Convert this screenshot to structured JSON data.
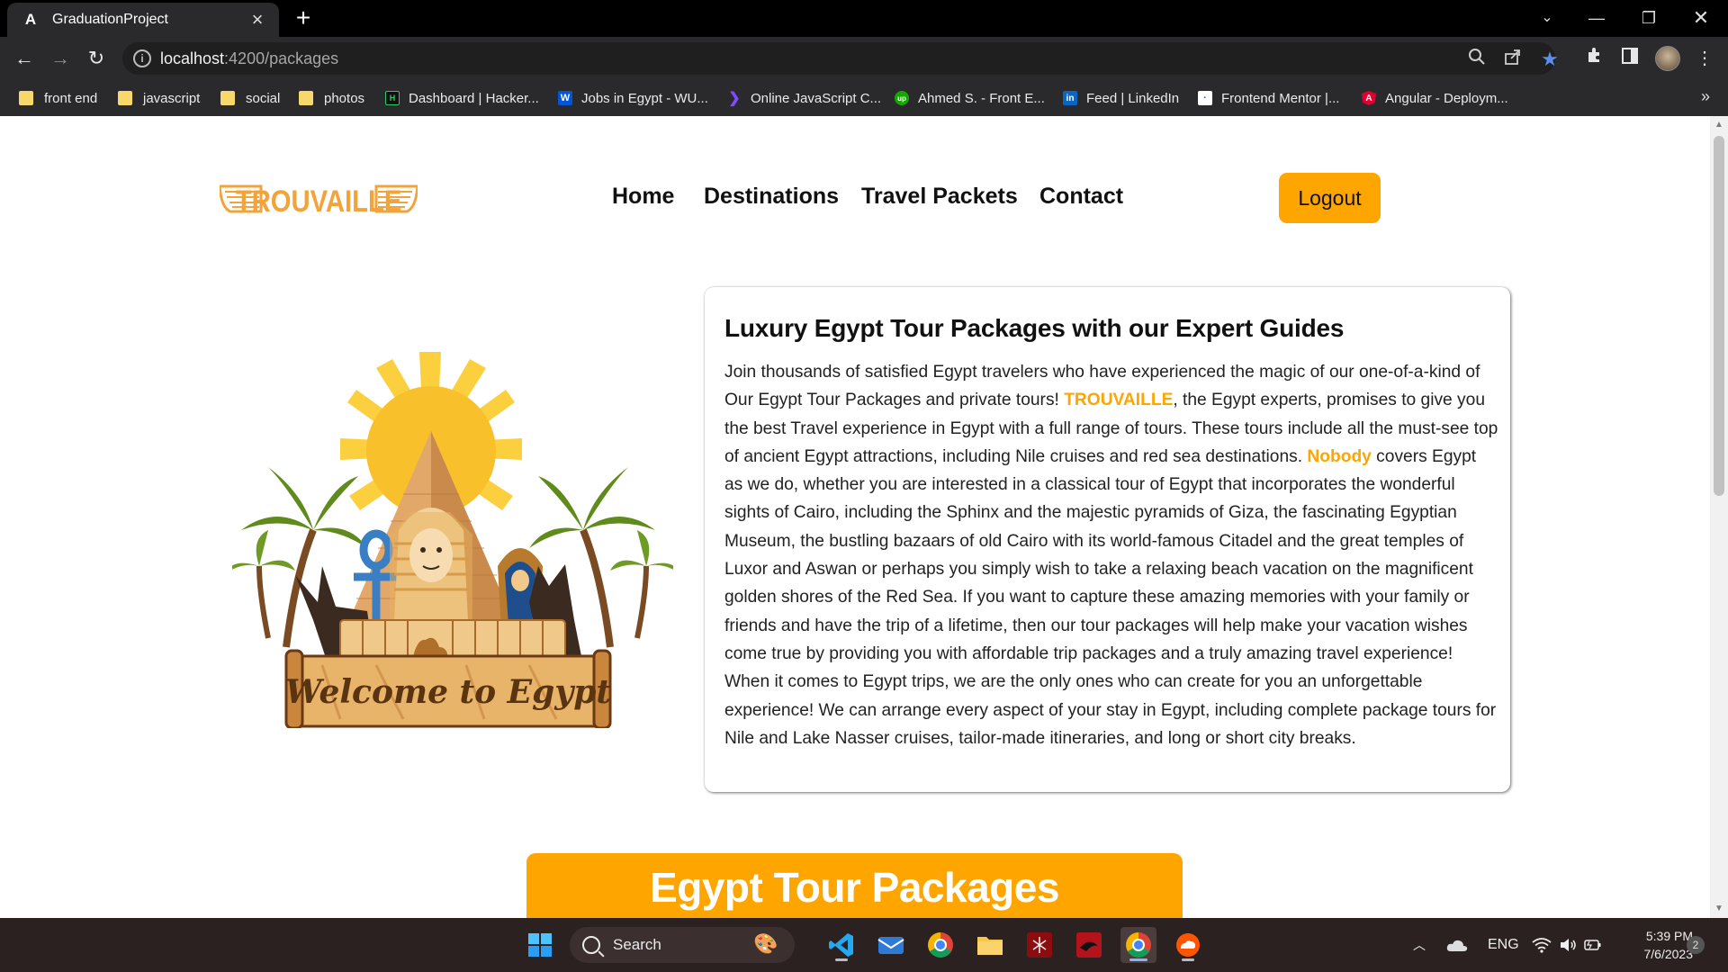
{
  "browser": {
    "tab_title": "GraduationProject",
    "tab_favicon": "A",
    "url_host": "localhost",
    "url_path": ":4200/packages",
    "bookmarks": [
      {
        "label": "front end",
        "icon": "folder"
      },
      {
        "label": "javascript",
        "icon": "folder"
      },
      {
        "label": "social",
        "icon": "folder"
      },
      {
        "label": "photos",
        "icon": "folder"
      },
      {
        "label": "Dashboard | Hacker...",
        "icon": "hackerrank"
      },
      {
        "label": "Jobs in Egypt - WU...",
        "icon": "wuzzuf"
      },
      {
        "label": "Online JavaScript C...",
        "icon": "programiz"
      },
      {
        "label": "Ahmed S. - Front E...",
        "icon": "upwork"
      },
      {
        "label": "Feed | LinkedIn",
        "icon": "linkedin"
      },
      {
        "label": "Frontend Mentor |...",
        "icon": "frontend-mentor"
      },
      {
        "label": "Angular - Deploym...",
        "icon": "angular"
      }
    ]
  },
  "site": {
    "nav": [
      "Home",
      "Destinations",
      "Travel Packets",
      "Contact"
    ],
    "logout_label": "Logout",
    "logo_text": "TROUVAILLE",
    "illustration_text": "Welcome to Egypt",
    "card": {
      "title": "Luxury Egypt Tour Packages with our Expert Guides",
      "body_1": "Join thousands of satisfied Egypt travelers who have experienced the magic of our one-of-a-kind of Our Egypt Tour Packages and private tours! ",
      "highlight_1": "TROUVAILLE",
      "body_2": ", the Egypt experts, promises to give you the best Travel experience in Egypt with a full range of tours. These tours include all the must-see top of ancient Egypt attractions, including Nile cruises and red sea destinations. ",
      "highlight_2": "Nobody",
      "body_3": " covers Egypt as we do, whether you are interested in a classical tour of Egypt that incorporates the wonderful sights of Cairo, including the Sphinx and the majestic pyramids of Giza, the fascinating Egyptian Museum, the bustling bazaars of old Cairo with its world-famous Citadel and the great temples of Luxor and Aswan or perhaps you simply wish to take a relaxing beach vacation on the magnificent golden shores of the Red Sea. If you want to capture these amazing memories with your family or friends and have the trip of a lifetime, then our tour packages will help make your vacation wishes come true by providing you with affordable trip packages and a truly amazing travel experience! When it comes to Egypt trips, we are the only ones who can create for you an unforgettable experience! We can arrange every aspect of your stay in Egypt, including complete package tours for Nile and Lake Nasser cruises, tailor-made itineraries, and long or short city breaks."
    },
    "section_banner": "Egypt Tour Packages",
    "accent_color": "#ffa500"
  },
  "taskbar": {
    "search_label": "Search",
    "language": "ENG",
    "time": "5:39 PM",
    "date": "7/6/2023",
    "notification_count": "2"
  }
}
